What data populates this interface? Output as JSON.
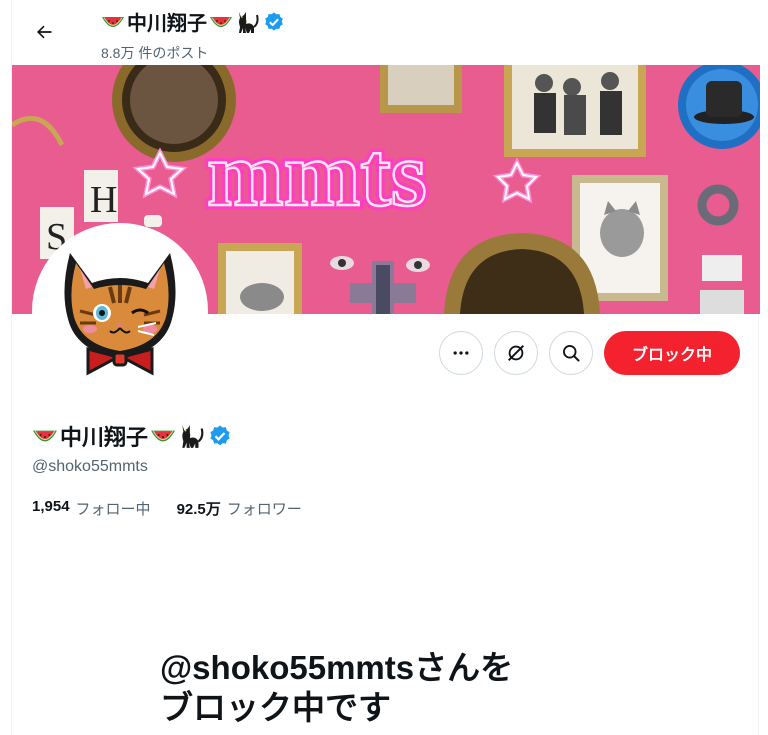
{
  "header": {
    "name": "中川翔子",
    "posts": "8.8万 件のポスト"
  },
  "banner": {
    "neon_text": "mmts",
    "sign_letter_h": "H",
    "sign_letter_s": "S"
  },
  "actions": {
    "block_label": "ブロック中"
  },
  "profile": {
    "name": "中川翔子",
    "handle": "@shoko55mmts",
    "following_count": "1,954",
    "following_label": "フォロー中",
    "followers_count": "92.5万",
    "followers_label": "フォロワー"
  },
  "blocked": {
    "line1": "@shoko55mmtsさんを",
    "line2": "ブロック中です"
  },
  "colors": {
    "block_red": "#f4212e",
    "verified_blue": "#1d9bf0",
    "banner_pink": "#e85c8f",
    "neon_pink": "#ff3fc0"
  },
  "icons": [
    "back-arrow-icon",
    "watermelon-icon",
    "black-cat-icon",
    "verified-badge-icon",
    "more-icon",
    "grok-icon",
    "search-icon"
  ]
}
